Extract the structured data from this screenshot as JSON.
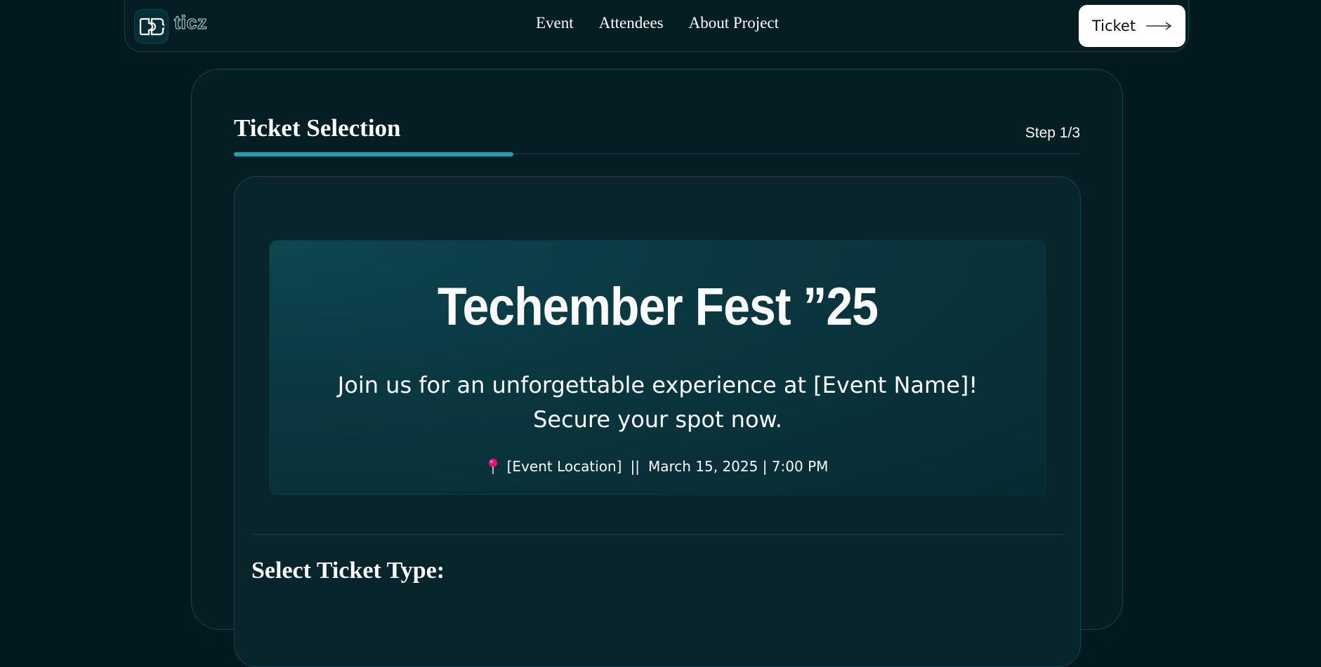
{
  "navbar": {
    "logo_text": "ticz",
    "links": [
      "Event",
      "Attendees",
      "About Project"
    ],
    "cta_label": "Ticket"
  },
  "main": {
    "title": "Ticket Selection",
    "step": "Step 1/3",
    "progress": 0.33,
    "hero": {
      "title": "Techember Fest ”25",
      "description": "Join us for an unforgettable experience at [Event Name]! Secure your spot now.",
      "location": "[Event Location]",
      "separator": "||",
      "datetime": "March 15, 2025 | 7:00 PM"
    },
    "select_type_label": "Select Ticket Type:"
  },
  "colors": {
    "background": "#02191d",
    "border": "#0e464f",
    "accent": "#24a0b5",
    "pin": "#e5107f"
  },
  "icons": [
    "logo-ticket-icon",
    "arrow-right-icon",
    "location-pin-icon"
  ]
}
